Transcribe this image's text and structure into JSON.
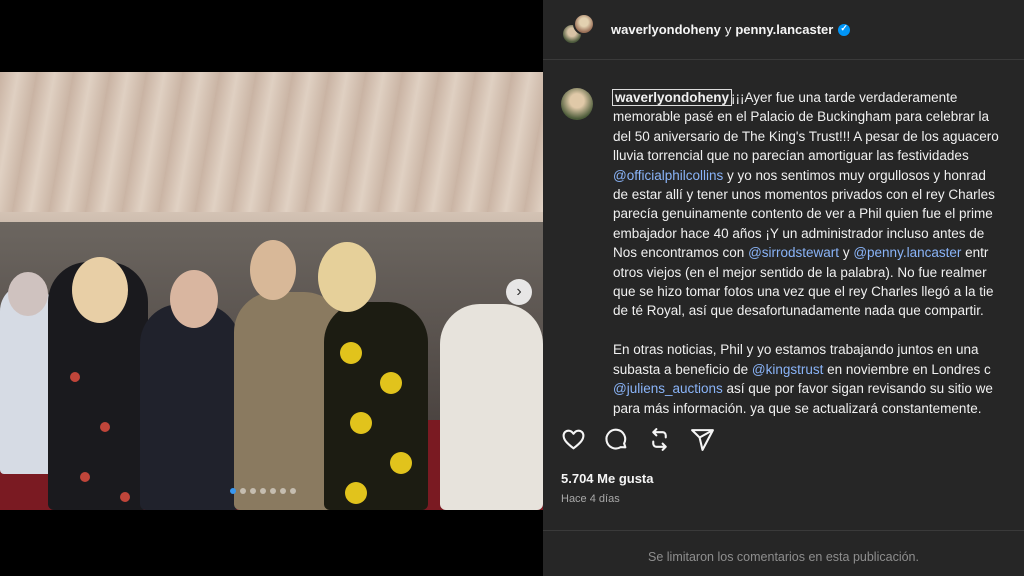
{
  "post": {
    "header": {
      "user1": "waverlyondoheny",
      "conj": "y",
      "user2": "penny.lancaster"
    },
    "caption": {
      "username": "waverlyondoheny",
      "l1_text": "¡¡¡Ayer fue una tarde verdaderamente",
      "l2": "memorable pasé en el Palacio de Buckingham para celebrar la",
      "l3": "del 50 aniversario de The King's Trust!!! A pesar de los aguacero",
      "l4": "lluvia torrencial que no parecían amortiguar las festividades",
      "l5_mention": "@officialphilcollins",
      "l5_text": " y yo nos sentimos muy orgullosos y honrad",
      "l6": "de estar allí y tener unos momentos privados con el rey Charles",
      "l7": "parecía genuinamente contento de ver a Phil quien fue el prime",
      "l8": "embajador hace 40 años ¡Y un administrador incluso antes de",
      "l9_text1": "Nos encontramos con ",
      "l9_mention1": "@sirrodstewart",
      "l9_text2": " y ",
      "l9_mention2": "@penny.lancaster",
      "l9_text3": " entr",
      "l10": "otros viejos (en el mejor sentido de la palabra). No fue realmer",
      "l11": "que se hizo tomar fotos una vez que el rey Charles llegó a la tie",
      "l12": "de té Royal, así que desafortunadamente nada que compartir.",
      "l13": "En otras noticias, Phil y yo estamos trabajando juntos en una",
      "l14_text1": "subasta a beneficio de ",
      "l14_mention": "@kingstrust",
      "l14_text2": " en noviembre en Londres c",
      "l15_mention": "@juliens_auctions",
      "l15_text": " así que por favor sigan revisando su sitio we",
      "l16": "para más información. ya que se actualizará constantemente."
    },
    "likes": "5.704 Me gusta",
    "time_ago": "Hace 4 días",
    "comments_limited": "Se limitaron los comentarios en esta publicación."
  },
  "icons": {
    "like": "heart-icon",
    "comment": "comment-icon",
    "repost": "repost-icon",
    "share": "send-icon",
    "next": "chevron-right-icon"
  },
  "colors": {
    "panel": "#262626",
    "mention": "#8ab4f8",
    "verified": "#0095f6"
  }
}
